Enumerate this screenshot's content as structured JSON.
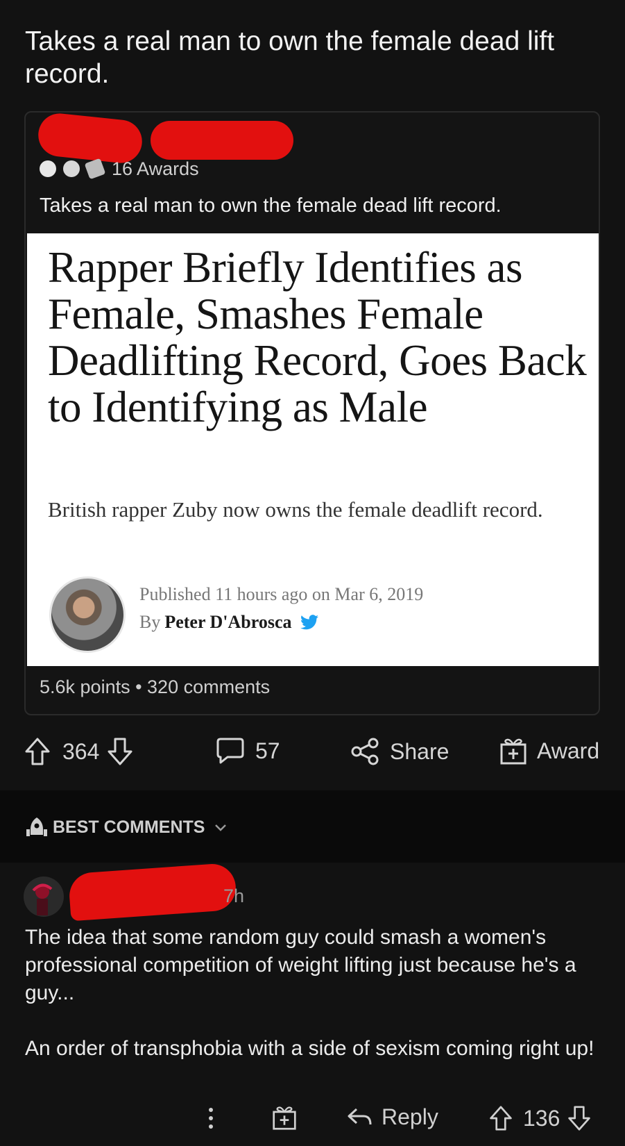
{
  "post": {
    "title": "Takes a real man to own the female dead lift record."
  },
  "crosspost": {
    "awards_count": "16 Awards",
    "title": "Takes a real man to own the female dead lift record.",
    "stats": "5.6k points • 320 comments",
    "article": {
      "headline": "Rapper Briefly Identifies as Female, Smashes Female Deadlifting Record, Goes Back to Identifying as Male",
      "dek": "British rapper Zuby now owns the female deadlift record.",
      "published": "Published 11 hours ago on Mar 6, 2019",
      "by_prefix": "By",
      "author": "Peter D'Abrosca"
    }
  },
  "actions": {
    "upvotes": "364",
    "comments": "57",
    "share_label": "Share",
    "award_label": "Award"
  },
  "sort": {
    "label": "BEST COMMENTS"
  },
  "comment": {
    "time": "7h",
    "paragraphs": [
      "The idea that some random guy could smash a women's professional competition of weight lifting just because he's a guy...",
      "An order of transphobia with a side of sexism coming right up!"
    ],
    "reply_label": "Reply",
    "score": "136"
  },
  "colors": {
    "background": "#121212",
    "redaction": "#e2100f",
    "twitter": "#1da1f2"
  }
}
